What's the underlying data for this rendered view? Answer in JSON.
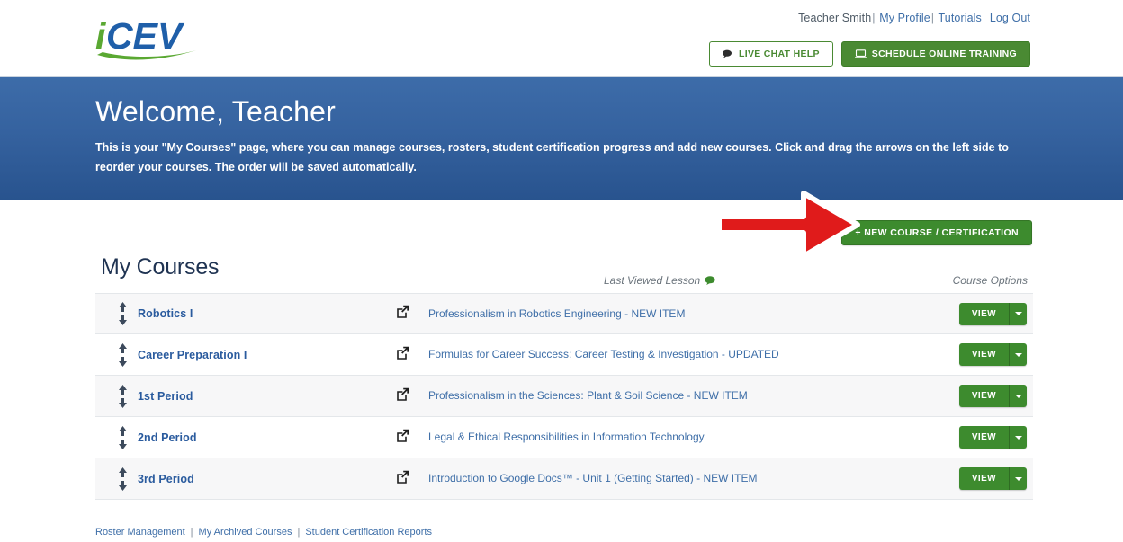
{
  "header": {
    "logo_text": "iCEV",
    "logo_colors": {
      "i": "#5aa832",
      "cev": "#1f5fa9",
      "swoosh": "#5aa832"
    },
    "user_name": "Teacher Smith",
    "links": [
      {
        "label": "My Profile"
      },
      {
        "label": "Tutorials"
      },
      {
        "label": "Log Out"
      }
    ],
    "separator": "|",
    "buttons": {
      "live_chat": {
        "label": "LIVE CHAT HELP",
        "icon": "chat-bubble-icon"
      },
      "schedule_training": {
        "label": "SCHEDULE ONLINE TRAINING",
        "icon": "monitor-icon"
      }
    }
  },
  "hero": {
    "title": "Welcome, Teacher",
    "description": "This is your \"My Courses\" page, where you can manage courses, rosters, student certification progress and add new courses. Click and drag the arrows on the left side to reorder your courses. The order will be saved automatically.",
    "background_color": "#35629f"
  },
  "actions": {
    "new_course": {
      "label": "+ NEW COURSE / CERTIFICATION",
      "color": "#3d8b2e"
    },
    "annotation_arrow": {
      "name": "red-arrow-annotation",
      "color": "#e01b1b"
    }
  },
  "courses_section": {
    "title": "My Courses",
    "columns": {
      "lesson": "Last Viewed Lesson",
      "lesson_icon": "comment-bubble-icon",
      "options": "Course Options"
    },
    "rows": [
      {
        "name": "Robotics I",
        "lesson": "Professionalism in Robotics Engineering - NEW ITEM",
        "action": "VIEW",
        "link_icon": "external-link-icon",
        "reorder_icons": [
          "arrow-up-icon",
          "arrow-down-icon"
        ]
      },
      {
        "name": "Career Preparation I",
        "lesson": "Formulas for Career Success: Career Testing & Investigation - UPDATED",
        "action": "VIEW",
        "link_icon": "external-link-icon",
        "reorder_icons": [
          "arrow-up-icon",
          "arrow-down-icon"
        ]
      },
      {
        "name": "1st Period",
        "lesson": "Professionalism in the Sciences: Plant & Soil Science - NEW ITEM",
        "action": "VIEW",
        "link_icon": "external-link-icon",
        "reorder_icons": [
          "arrow-up-icon",
          "arrow-down-icon"
        ]
      },
      {
        "name": "2nd Period",
        "lesson": "Legal & Ethical Responsibilities in Information Technology",
        "action": "VIEW",
        "link_icon": "external-link-icon",
        "reorder_icons": [
          "arrow-up-icon",
          "arrow-down-icon"
        ]
      },
      {
        "name": "3rd Period",
        "lesson": "Introduction to Google Docs™ - Unit 1 (Getting Started) - NEW ITEM",
        "action": "VIEW",
        "link_icon": "external-link-icon",
        "reorder_icons": [
          "arrow-up-icon",
          "arrow-down-icon"
        ]
      }
    ]
  },
  "footer": {
    "links": [
      {
        "label": "Roster Management"
      },
      {
        "label": "My Archived Courses"
      },
      {
        "label": "Student Certification Reports"
      }
    ],
    "separator": "|"
  }
}
